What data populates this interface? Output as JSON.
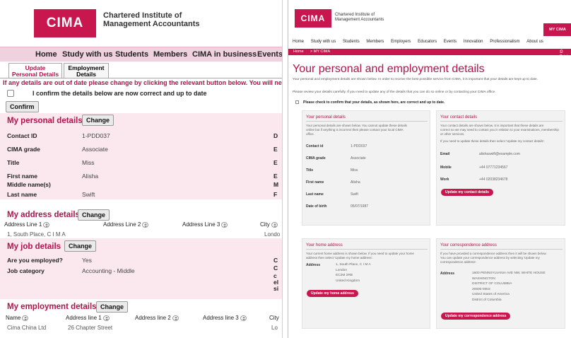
{
  "left": {
    "logo": "CIMA",
    "org_line1": "Chartered Institute of",
    "org_line2": "Management Accountants",
    "nav": [
      "Home",
      "Study with us",
      "Students",
      "Members",
      "CIMA in business",
      "Events"
    ],
    "tabs": [
      {
        "line1": "Update",
        "line2": "Personal Details"
      },
      {
        "line1": "Employment",
        "line2": "Details"
      }
    ],
    "notice": "If any details are out of date please change by clicking the relevant button below. You will need to",
    "confirm_text": "I confirm the details below are now correct and up to date",
    "confirm_button": "Confirm",
    "change_label": "Change",
    "personal": {
      "title": "My personal details",
      "rows": [
        {
          "label": "Contact ID",
          "value": "1-PDD037",
          "edge": "D"
        },
        {
          "label": "CIMA grade",
          "value": "Associate",
          "edge": "E"
        },
        {
          "label": "Title",
          "value": "Miss",
          "edge": "E"
        },
        {
          "label": "First name",
          "value": "Alisha",
          "edge": "E"
        },
        {
          "label": "Middle name(s)",
          "value": "",
          "edge": "M"
        },
        {
          "label": "Last name",
          "value": "Swift",
          "edge": "F"
        }
      ]
    },
    "address": {
      "title": "My address details",
      "cols": [
        "Address Line 1",
        "Address Line 2",
        "Address Line 3",
        "City"
      ],
      "row": {
        "line1": "1, South Place, C I M A",
        "city": "Londo"
      }
    },
    "job": {
      "title": "My job details",
      "rows": [
        {
          "label": "Are you employed?",
          "value": "Yes",
          "edge": "C"
        },
        {
          "label": "Job category",
          "value": "Accounting - Middle",
          "edge": "C"
        }
      ],
      "edge_extra": [
        "c",
        "el",
        "si"
      ]
    },
    "employment": {
      "title": "My employment details",
      "cols": [
        "Name",
        "Address line 1",
        "Address line 2",
        "Address line 3",
        "City"
      ],
      "row": {
        "name": "Cima China Ltd",
        "line1": "26 Chapter Street",
        "city": "Lo"
      }
    }
  },
  "right": {
    "logo": "CIMA",
    "org_line1": "Chartered Institute of",
    "org_line2": "Management Accountants",
    "my_cima": "MY CIMA",
    "nav": [
      "Home",
      "Study with us",
      "Students",
      "Members",
      "Employers",
      "Educators",
      "Events",
      "Innovation",
      "Professionalism",
      "About us"
    ],
    "crumb_home": "Home",
    "crumb_current": "> MY CIMA",
    "print": "Print",
    "title": "Your personal and employment details",
    "intro1": "Your personal and employment details are shown below. In order to receive the best possible service from CIMA, it is important that your details are kept up to date.",
    "intro2": "Please review your details carefully. If you need to update any of the details that you can do so online or by contacting your CIMA office.",
    "confirm_text": "Please check to confirm that your details, as shown here, are correct and up to date.",
    "personal_card": {
      "title": "Your personal details",
      "text1": "Your personal details are shown below. You cannot update these details",
      "text2": "online but if anything is incorrect then please contact your local CIMA",
      "text3": "office.",
      "rows": [
        {
          "label": "Contact id",
          "value": "1-PDD037"
        },
        {
          "label": "CIMA grade",
          "value": "Associate"
        },
        {
          "label": "Title",
          "value": "Miss"
        },
        {
          "label": "First name",
          "value": "Alisha"
        },
        {
          "label": "Last name",
          "value": "Swift"
        },
        {
          "label": "Date of birth",
          "value": "05/07/1987"
        }
      ]
    },
    "contact_card": {
      "title": "Your contact details",
      "text1": "Your contact details are shown below. It is important that these details are",
      "text2": "correct so we may need to contact you in relation to your examinations, membership",
      "text3": "or other services.",
      "text4": "If you need to update these details then select 'Update my contact details'.",
      "rows": [
        {
          "label": "Email",
          "value": "alishaswift@example.com"
        },
        {
          "label": "Mobile",
          "value": "+44 07771234567"
        },
        {
          "label": "Work",
          "value": "+44 02038234678"
        }
      ],
      "button": "Update my contact details"
    },
    "home_card": {
      "title": "Your home address",
      "text1": "Your current home address is shown below. If you need to update your home",
      "text2": "address then select 'Update my home address'.",
      "label": "Address",
      "lines": [
        "1, South Place, C I M A",
        "London",
        "EC2M 2RB",
        "United Kingdom"
      ],
      "button": "Update my home address"
    },
    "corr_card": {
      "title": "Your correspondence address",
      "text1": "If you have provided a correspondence address then it will be shown below.",
      "text2": "You can update your correspondence address by selecting 'Update my",
      "text3": "correspondence address'.",
      "label": "Address",
      "lines": [
        "1600 PENNSYLVANIA AVE NW, WHITE HOUSE",
        "WASHINGTON",
        "DISTRICT OF COLUMBIA",
        "20500-0003",
        "United States of America",
        "District of Columbia"
      ],
      "button": "Update my correspondence address"
    }
  },
  "colors": {
    "brand": "#c8174f",
    "heading": "#b0144a",
    "pinkbg": "#fbe8ef",
    "card": "#f2f2f2"
  }
}
